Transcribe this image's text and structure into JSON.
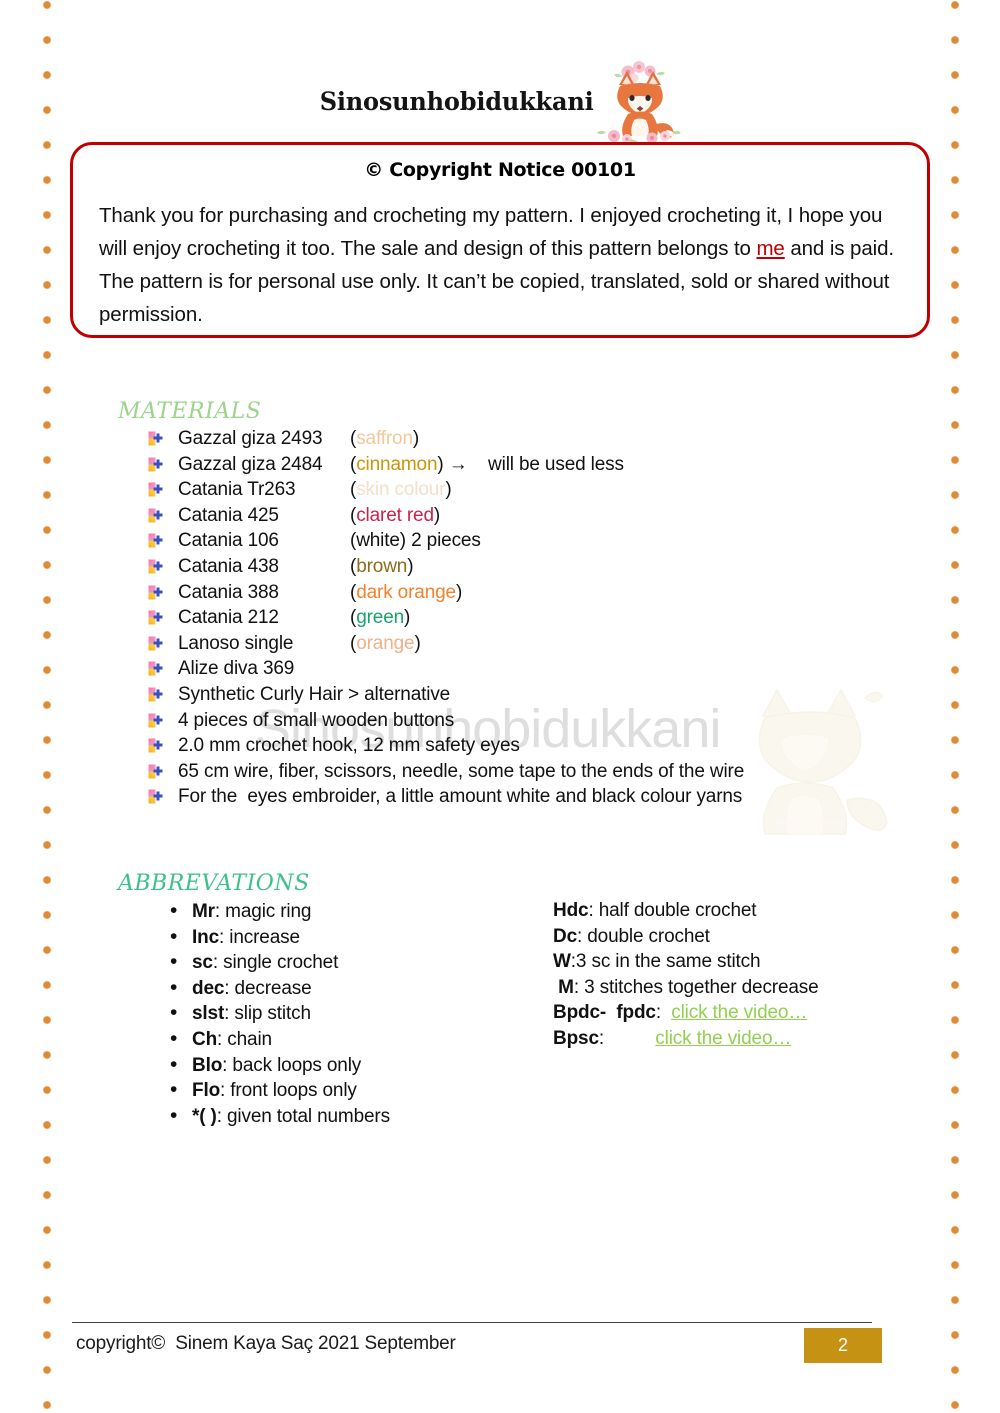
{
  "header": {
    "brand": "Sinosunhobidukkani",
    "logo_icon": "fox-logo-icon"
  },
  "copyright": {
    "title": "© Copyright Notice 00101",
    "body_part1": "Thank you for purchasing and crocheting my pattern. I enjoyed crocheting it, I hope you will enjoy crocheting it too. The sale and design of this pattern belongs to ",
    "link_label": "me",
    "body_part2": " and is paid. The pattern is for personal use only. It can’t be copied, translated, sold or shared without permission.",
    "border_color": "#c00000",
    "link_color": "#c00000"
  },
  "materials": {
    "heading": "MATERIALS",
    "heading_color": "#9bd48a",
    "bullet_icon": "four-color-cross-bullet-icon",
    "items": [
      {
        "name": "Gazzal giza 2493",
        "color_label": "(saffron)",
        "color_value": "#f0c99a",
        "extra": ""
      },
      {
        "name": "Gazzal giza 2484",
        "color_label": "(cinnamon)",
        "color_value": "#c8960c",
        "extra": " →    will be used less"
      },
      {
        "name": "Catania Tr263",
        "color_label": "(skin colour)",
        "color_value": "#f2e0c8",
        "extra": ""
      },
      {
        "name": "Catania 425",
        "color_label": "(claret red)",
        "color_value": "#c9234a",
        "extra": ""
      },
      {
        "name": "Catania 106",
        "color_label": "(white)",
        "color_value": "#111111",
        "extra": " 2 pieces"
      },
      {
        "name": "Catania 438",
        "color_label": "(brown)",
        "color_value": "#8a6d1f",
        "extra": ""
      },
      {
        "name": "Catania 388",
        "color_label": "(dark orange)",
        "color_value": "#f2822b",
        "extra": ""
      },
      {
        "name": "Catania 212",
        "color_label": "(green)",
        "color_value": "#18a36a",
        "extra": ""
      },
      {
        "name": "Lanoso single",
        "color_label": "(orange)",
        "color_value": "#f0b089",
        "extra": ""
      },
      {
        "name": "Alize diva 369",
        "color_label": "",
        "color_value": "#111111",
        "extra": ""
      }
    ],
    "wide_items": [
      "Synthetic Curly Hair > alternative",
      "4 pieces of small wooden buttons",
      "2.0 mm crochet hook, 12 mm safety eyes",
      "65 cm wire, fiber, scissors, needle, some tape to the ends of the wire",
      "For the  eyes embroider, a little amount white and black colour yarns"
    ]
  },
  "watermark": {
    "text": "Sinosunhobidukkani",
    "fox_icon": "fox-watermark-icon"
  },
  "abbreviations": {
    "heading": "ABBREVATIONS",
    "heading_color": "#3fc08a",
    "left_column": [
      {
        "bullet": "•",
        "term": "Mr",
        "def": ": magic ring"
      },
      {
        "bullet": "•",
        "term": "Inc",
        "def": ": increase"
      },
      {
        "bullet": "•",
        "term": "sc",
        "def": ": single crochet"
      },
      {
        "bullet": "•",
        "term": "dec",
        "def": ": decrease"
      },
      {
        "bullet": "•",
        "term": "slst",
        "def": ": slip stitch"
      },
      {
        "bullet": "•",
        "term": "Ch",
        "def": ": chain"
      },
      {
        "bullet": "•",
        "term": "Blo",
        "def": ": back loops only"
      },
      {
        "bullet": "•",
        "term": "Flo",
        "def": ": front loops only"
      },
      {
        "bullet": "•",
        "term": "*( )",
        "def": ": given total numbers"
      }
    ],
    "right_column": [
      {
        "term": "Hdc",
        "def": ": half double crochet",
        "link": ""
      },
      {
        "term": "Dc",
        "def": ": double crochet",
        "link": ""
      },
      {
        "term": "W",
        "def": ":3 sc in the same stitch",
        "link": ""
      },
      {
        "term": " M",
        "def": ": 3 stitches together decrease",
        "link": ""
      },
      {
        "term": "Bpdc-  fpdc",
        "def": ":  ",
        "link": "click the video…"
      },
      {
        "term": "Bpsc",
        "def": ":          ",
        "link": "click the video…"
      }
    ],
    "link_color": "#92d050"
  },
  "footer": {
    "text": "copyright©  Sinem Kaya Saç 2021 September",
    "page_number": "2",
    "badge_color": "#c69214"
  },
  "decoration": {
    "dot_color": "#e08a35"
  }
}
